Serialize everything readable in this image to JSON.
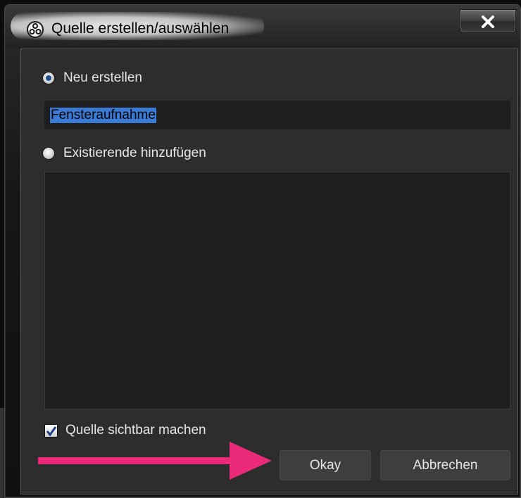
{
  "window": {
    "title": "Quelle erstellen/auswählen",
    "close_glyph": "x"
  },
  "options": {
    "create_new_label": "Neu erstellen",
    "create_new_selected": true,
    "add_existing_label": "Existierende hinzufügen",
    "add_existing_selected": false
  },
  "name_input": {
    "value": "Fensteraufnahme",
    "text_selected": true
  },
  "existing_sources": [],
  "visibility": {
    "label": "Quelle sichtbar machen",
    "checked": true
  },
  "buttons": {
    "okay_label": "Okay",
    "cancel_label": "Abbrechen"
  },
  "annotation": {
    "arrow_color": "#ec2a7a",
    "points_to": "okay-button"
  },
  "icons": {
    "app": "obs-logo-icon",
    "close": "close-icon",
    "check": "check-icon",
    "arrow": "arrow-right-icon"
  }
}
